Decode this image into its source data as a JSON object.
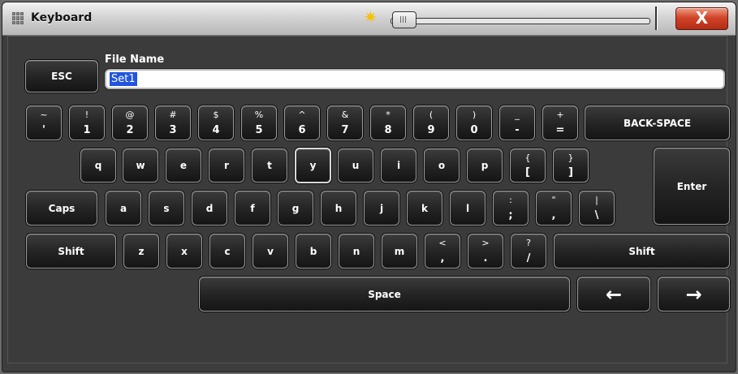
{
  "window": {
    "title": "Keyboard",
    "icon": "keyboard-grid-icon",
    "close_label": "X"
  },
  "brightness": {
    "icon": "sun-icon"
  },
  "file_name": {
    "label": "File Name",
    "value": "Set1"
  },
  "keys": {
    "esc": "ESC",
    "tilde": {
      "top": "~",
      "bottom": "'"
    },
    "n1": {
      "top": "!",
      "bottom": "1"
    },
    "n2": {
      "top": "@",
      "bottom": "2"
    },
    "n3": {
      "top": "#",
      "bottom": "3"
    },
    "n4": {
      "top": "$",
      "bottom": "4"
    },
    "n5": {
      "top": "%",
      "bottom": "5"
    },
    "n6": {
      "top": "^",
      "bottom": "6"
    },
    "n7": {
      "top": "&",
      "bottom": "7"
    },
    "n8": {
      "top": "*",
      "bottom": "8"
    },
    "n9": {
      "top": "(",
      "bottom": "9"
    },
    "n0": {
      "top": ")",
      "bottom": "0"
    },
    "minus": {
      "top": "_",
      "bottom": "-"
    },
    "equals": {
      "top": "+",
      "bottom": "="
    },
    "backspace": {
      "line1": "BACK-",
      "line2": "SPACE"
    },
    "q": "q",
    "w": "w",
    "e": "e",
    "r": "r",
    "t": "t",
    "y": "y",
    "u": "u",
    "i": "i",
    "o": "o",
    "p": "p",
    "lbracket": {
      "top": "{",
      "bottom": "["
    },
    "rbracket": {
      "top": "}",
      "bottom": "]"
    },
    "enter": "Enter",
    "caps": "Caps",
    "a": "a",
    "s": "s",
    "d": "d",
    "f": "f",
    "g": "g",
    "h": "h",
    "j": "j",
    "k": "k",
    "l": "l",
    "semicolon": {
      "top": ":",
      "bottom": ";"
    },
    "quote": {
      "top": "\"",
      "bottom": ","
    },
    "backslash": {
      "top": "|",
      "bottom": "\\"
    },
    "shift_left": "Shift",
    "z": "z",
    "x": "x",
    "c": "c",
    "v": "v",
    "b": "b",
    "n": "n",
    "m": "m",
    "comma": {
      "top": "<",
      "bottom": ","
    },
    "period": {
      "top": ">",
      "bottom": "."
    },
    "slash": {
      "top": "?",
      "bottom": "/"
    },
    "shift_right": "Shift",
    "space": "Space",
    "arrow_left": "←",
    "arrow_right": "→"
  }
}
